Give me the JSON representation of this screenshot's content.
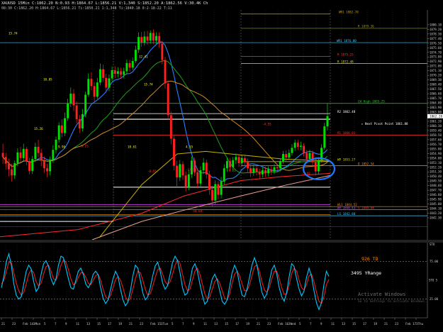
{
  "header": {
    "line1": "XAUUSD 15Min  C:1862.20  N:0.93  H:1864.67  L:1856.21  V:1,340  S:1852.20  A:1862.56  V:30.4K  Ch",
    "line2": "08:30  C:1862.20  H:1864.67  L:1856.21  Ti:1850.21  1:1,348  Ti:1840.18  0:2-18-22  T:11"
  },
  "chart_data": {
    "type": "line",
    "title": "XAUUSD 15Min",
    "ylim": [
      1838.0,
      1883.0
    ],
    "y_ticks": [
      1880.1,
      1879.2,
      1878.3,
      1877.4,
      1876.5,
      1875.6,
      1874.7,
      1873.8,
      1872.9,
      1872.0,
      1871.1,
      1870.2,
      1869.3,
      1868.4,
      1867.5,
      1866.6,
      1865.7,
      1864.8,
      1863.9,
      1863.0,
      1862.1,
      1861.2,
      1860.3,
      1859.4,
      1858.5,
      1857.6,
      1856.7,
      1855.8,
      1854.9,
      1854.0,
      1853.1,
      1852.2,
      1851.3,
      1850.4,
      1849.5,
      1848.6,
      1847.7,
      1846.8,
      1845.9,
      1845.0,
      1844.1,
      1843.2,
      1842.3
    ],
    "price_tag": "1862.20",
    "levels": [
      {
        "name": "WR1 1882.78",
        "value": 1882.2,
        "color": "#c8a000",
        "label_pos": "top"
      },
      {
        "name": "R 1879.36",
        "value": 1879.4,
        "color": "#a0a000",
        "label_pos": "right"
      },
      {
        "name": "WR1 1876.80",
        "value": 1876.6,
        "color": "#40c8ff",
        "label_pos": "left"
      },
      {
        "name": "R 1875.15",
        "value": 1873.9,
        "color": "#ff3030",
        "label_pos": "mid"
      },
      {
        "name": "R 1872.48",
        "value": 1872.5,
        "color": "#dddd00",
        "label_pos": "mid"
      },
      {
        "name": "LW High 1865.25",
        "value": 1864.7,
        "color": "#20d020",
        "label_pos": "right"
      },
      {
        "name": "R2 1862.48",
        "value": 1862.7,
        "color": "#ffffff",
        "label_pos": "mid"
      },
      {
        "name": "R1 1860.01",
        "value": 1858.5,
        "color": "#ff3030",
        "label_pos": "mid"
      },
      {
        "name": "WP 1853.27",
        "value": 1853.3,
        "color": "#dddd00",
        "label_pos": "mid"
      },
      {
        "name": "D 1852.54",
        "value": 1852.5,
        "color": "#ff8c00",
        "label_pos": "right"
      },
      {
        "name": "WL1 1844.52",
        "value": 1844.5,
        "color": "#ff8c00",
        "label_pos": "mid"
      },
      {
        "name": "WP 1844.43",
        "value": 1843.9,
        "color": "#d040ff",
        "label_pos": "mid"
      },
      {
        "name": "S 1844.04",
        "value": 1843.9,
        "color": "#ff3030",
        "label_pos": "right"
      },
      {
        "name": "LS 1842.88",
        "value": 1842.7,
        "color": "#40c8ff",
        "label_pos": "mid"
      }
    ],
    "annotations": [
      {
        "text": "Next Pivot Point 1861.88",
        "value": 1860.5,
        "color": "#ffffff"
      },
      {
        "text": "TD 926",
        "value": null,
        "color": "#ff8c00"
      },
      {
        "text": "YRange 3495",
        "value": null,
        "color": "#ffffff"
      },
      {
        "text": "15.74",
        "value": 1868.2,
        "color": "#ffff00"
      },
      {
        "text": "12.41",
        "value": 1873.6,
        "color": "#ffff00"
      },
      {
        "text": "10.85",
        "value": 1869.2,
        "color": "#ffff00"
      },
      {
        "text": "15.74",
        "value": 1878.2,
        "color": "#ffff00"
      },
      {
        "text": "15.26",
        "value": 1859.5,
        "color": "#ffff00"
      },
      {
        "text": "10.61",
        "value": 1856.0,
        "color": "#ffff00"
      },
      {
        "text": "9.96",
        "value": 1856.0,
        "color": "#ffff00"
      },
      {
        "text": "4.15",
        "value": 1856.0,
        "color": "#ffff00"
      },
      {
        "text": "-8.55",
        "value": 1851.2,
        "color": "#ff3030"
      },
      {
        "text": "-17.10",
        "value": 1851.5,
        "color": "#ff3030"
      },
      {
        "text": "-4.55",
        "value": 1860.4,
        "color": "#ff3030"
      },
      {
        "text": "-5.93",
        "value": 1850.8,
        "color": "#ff3030"
      },
      {
        "text": "-10.64",
        "value": 1843.4,
        "color": "#ff3030"
      },
      {
        "text": "-6.82",
        "value": 1853.6,
        "color": "#ff3030"
      },
      {
        "text": "-3.23",
        "value": 1856.1,
        "color": "#ff3030"
      },
      {
        "text": "-9.21",
        "value": 1851.3,
        "color": "#ff3030"
      }
    ],
    "oscillator": {
      "labels": [
        "STO",
        "STO 5"
      ],
      "levels": [
        "25.00",
        "75.00"
      ],
      "range": [
        0,
        100
      ],
      "fast": [
        40,
        55,
        75,
        85,
        70,
        45,
        30,
        25,
        28,
        45,
        62,
        70,
        65,
        48,
        35,
        40,
        58,
        72,
        76,
        68,
        52,
        44,
        52,
        70,
        82,
        80,
        66,
        52,
        40,
        38,
        50,
        62,
        66,
        58,
        45,
        40,
        46,
        58,
        62,
        57,
        40,
        26,
        19,
        24,
        38,
        52,
        62,
        55,
        38,
        24,
        16,
        21,
        36,
        56,
        70,
        66,
        50,
        33,
        24,
        28,
        40,
        56,
        69,
        74,
        62,
        46,
        38,
        43,
        58,
        74,
        82,
        76,
        60,
        40,
        30,
        33,
        48,
        66,
        72,
        62,
        45,
        30,
        18,
        22,
        38,
        52,
        58,
        50,
        36,
        22,
        18,
        24,
        42,
        60,
        70,
        62,
        45,
        30,
        28,
        38,
        54,
        70,
        80,
        70,
        52,
        34,
        26,
        32,
        48,
        64,
        70,
        58,
        40,
        28,
        22,
        34,
        55,
        72,
        68,
        52,
        38,
        29,
        36,
        54,
        66,
        55,
        36,
        20,
        11,
        20,
        44,
        62,
        55
      ],
      "slow": [
        45,
        50,
        62,
        74,
        73,
        60,
        46,
        36,
        30,
        34,
        45,
        58,
        64,
        60,
        48,
        42,
        46,
        58,
        68,
        70,
        62,
        52,
        50,
        58,
        70,
        77,
        74,
        64,
        52,
        44,
        46,
        54,
        60,
        60,
        54,
        46,
        44,
        50,
        56,
        58,
        50,
        38,
        28,
        25,
        30,
        40,
        51,
        55,
        50,
        40,
        28,
        22,
        26,
        38,
        52,
        62,
        60,
        50,
        38,
        30,
        32,
        42,
        54,
        64,
        66,
        58,
        48,
        44,
        48,
        58,
        70,
        77,
        72,
        58,
        44,
        36,
        38,
        50,
        62,
        66,
        58,
        45,
        32,
        24,
        28,
        38,
        48,
        52,
        46,
        36,
        26,
        24,
        32,
        46,
        58,
        62,
        56,
        45,
        36,
        36,
        44,
        56,
        68,
        70,
        62,
        48,
        37,
        34,
        40,
        52,
        62,
        62,
        52,
        40,
        31,
        32,
        44,
        59,
        66,
        62,
        50,
        40,
        37,
        44,
        56,
        58,
        48,
        34,
        22,
        19,
        28,
        44,
        51
      ],
      "last_values": [
        "73.50",
        "50.15"
      ]
    },
    "xaxis_labels": [
      "21",
      "23",
      "Feb 14 Mon",
      "3",
      "5",
      "7",
      "9",
      "11",
      "13",
      "15",
      "17",
      "19",
      "21",
      "23",
      "Feb 15 Tue",
      "3",
      "5",
      "7",
      "9",
      "11",
      "13",
      "15",
      "17",
      "19",
      "21",
      "23",
      "Feb 16 Wed",
      "3",
      "5",
      "7",
      "9",
      "11",
      "13",
      "15",
      "17",
      "19",
      "21",
      "23",
      "Feb 17 Thu",
      "3"
    ],
    "candles": [
      [
        1855.0,
        1854.2,
        1856.8,
        1852.9
      ],
      [
        1854.2,
        1852.9,
        1855.0,
        1851.8
      ],
      [
        1852.9,
        1851.8,
        1853.9,
        1850.4
      ],
      [
        1851.8,
        1850.6,
        1852.9,
        1849.4
      ],
      [
        1850.6,
        1853.0,
        1853.5,
        1849.9
      ],
      [
        1853.0,
        1855.1,
        1855.9,
        1852.4
      ],
      [
        1855.1,
        1854.0,
        1856.2,
        1853.2
      ],
      [
        1854.0,
        1855.8,
        1856.8,
        1853.3
      ],
      [
        1855.8,
        1853.4,
        1856.2,
        1852.6
      ],
      [
        1853.4,
        1851.5,
        1854.0,
        1850.8
      ],
      [
        1851.5,
        1853.8,
        1854.4,
        1850.9
      ],
      [
        1853.8,
        1856.2,
        1857.0,
        1853.2
      ],
      [
        1856.2,
        1855.0,
        1857.6,
        1854.2
      ],
      [
        1855.0,
        1853.5,
        1855.8,
        1852.4
      ],
      [
        1853.5,
        1852.0,
        1854.3,
        1851.1
      ],
      [
        1852.0,
        1851.4,
        1852.9,
        1850.3
      ],
      [
        1851.4,
        1853.6,
        1854.3,
        1850.6
      ],
      [
        1853.6,
        1855.6,
        1856.5,
        1853.1
      ],
      [
        1855.6,
        1857.6,
        1858.2,
        1854.9
      ],
      [
        1857.6,
        1860.4,
        1861.0,
        1857.0
      ],
      [
        1860.4,
        1858.9,
        1861.6,
        1858.1
      ],
      [
        1858.9,
        1861.8,
        1862.9,
        1858.3
      ],
      [
        1861.8,
        1864.7,
        1865.6,
        1861.3
      ],
      [
        1864.7,
        1866.6,
        1867.8,
        1864.0
      ],
      [
        1866.6,
        1864.3,
        1867.5,
        1863.2
      ],
      [
        1864.3,
        1861.6,
        1865.1,
        1860.8
      ],
      [
        1861.6,
        1859.8,
        1862.4,
        1858.9
      ],
      [
        1859.8,
        1862.6,
        1863.6,
        1859.2
      ],
      [
        1862.6,
        1866.4,
        1867.0,
        1862.0
      ],
      [
        1866.4,
        1869.5,
        1870.6,
        1866.0
      ],
      [
        1869.5,
        1868.1,
        1870.8,
        1867.3
      ],
      [
        1868.1,
        1866.0,
        1868.9,
        1865.1
      ],
      [
        1866.0,
        1868.8,
        1869.7,
        1865.6
      ],
      [
        1868.8,
        1871.4,
        1872.5,
        1868.2
      ],
      [
        1871.4,
        1869.7,
        1872.3,
        1868.9
      ],
      [
        1869.7,
        1867.8,
        1870.5,
        1866.8
      ],
      [
        1867.8,
        1869.6,
        1870.4,
        1867.1
      ],
      [
        1869.6,
        1871.2,
        1871.9,
        1869.0
      ],
      [
        1871.2,
        1870.5,
        1872.0,
        1869.6
      ],
      [
        1870.5,
        1871.0,
        1871.8,
        1869.8
      ],
      [
        1871.0,
        1870.3,
        1871.7,
        1869.5
      ],
      [
        1870.3,
        1871.0,
        1871.7,
        1869.6
      ],
      [
        1871.0,
        1872.6,
        1873.3,
        1870.4
      ],
      [
        1872.6,
        1871.7,
        1873.2,
        1870.9
      ],
      [
        1871.7,
        1873.0,
        1873.7,
        1871.2
      ],
      [
        1873.0,
        1875.2,
        1876.0,
        1872.6
      ],
      [
        1875.2,
        1877.7,
        1878.6,
        1874.6
      ],
      [
        1877.7,
        1876.6,
        1878.7,
        1875.8
      ],
      [
        1876.6,
        1877.8,
        1878.8,
        1876.0
      ],
      [
        1877.8,
        1877.0,
        1878.9,
        1876.2
      ],
      [
        1877.0,
        1878.5,
        1879.0,
        1876.4
      ],
      [
        1878.5,
        1877.0,
        1879.2,
        1876.3
      ],
      [
        1877.0,
        1877.9,
        1878.6,
        1876.3
      ],
      [
        1877.9,
        1876.4,
        1878.6,
        1875.6
      ],
      [
        1876.4,
        1873.2,
        1876.9,
        1872.4
      ],
      [
        1873.2,
        1868.6,
        1873.8,
        1867.6
      ],
      [
        1868.6,
        1862.4,
        1869.2,
        1861.5
      ],
      [
        1862.4,
        1857.8,
        1863.1,
        1856.7
      ],
      [
        1857.8,
        1852.5,
        1858.4,
        1851.6
      ],
      [
        1852.5,
        1850.2,
        1853.4,
        1848.3
      ],
      [
        1850.2,
        1852.8,
        1853.6,
        1849.5
      ],
      [
        1852.8,
        1850.6,
        1853.4,
        1849.7
      ],
      [
        1850.6,
        1848.3,
        1851.4,
        1847.4
      ],
      [
        1848.3,
        1850.8,
        1851.7,
        1847.7
      ],
      [
        1850.8,
        1853.5,
        1854.3,
        1850.1
      ],
      [
        1853.5,
        1851.2,
        1854.1,
        1850.5
      ],
      [
        1851.2,
        1849.0,
        1852.0,
        1848.1
      ],
      [
        1849.0,
        1851.6,
        1852.4,
        1848.3
      ],
      [
        1851.6,
        1853.1,
        1854.0,
        1850.9
      ],
      [
        1853.1,
        1850.8,
        1853.7,
        1850.0
      ],
      [
        1850.8,
        1847.8,
        1851.5,
        1846.8
      ],
      [
        1847.8,
        1845.7,
        1848.6,
        1844.5
      ],
      [
        1845.7,
        1848.9,
        1849.6,
        1845.0
      ],
      [
        1848.9,
        1846.8,
        1849.5,
        1845.9
      ],
      [
        1846.8,
        1849.4,
        1850.3,
        1846.1
      ],
      [
        1849.4,
        1852.0,
        1852.8,
        1848.8
      ],
      [
        1852.0,
        1853.4,
        1854.1,
        1851.3
      ],
      [
        1853.4,
        1852.2,
        1854.0,
        1851.4
      ],
      [
        1852.2,
        1853.6,
        1854.2,
        1851.5
      ],
      [
        1853.6,
        1854.2,
        1854.9,
        1852.8
      ],
      [
        1854.2,
        1853.0,
        1854.8,
        1852.3
      ],
      [
        1853.0,
        1854.0,
        1854.6,
        1852.4
      ],
      [
        1854.0,
        1853.2,
        1854.7,
        1852.4
      ],
      [
        1853.2,
        1852.0,
        1853.9,
        1851.2
      ],
      [
        1852.0,
        1851.1,
        1852.7,
        1850.3
      ],
      [
        1851.1,
        1852.0,
        1852.7,
        1850.5
      ],
      [
        1852.0,
        1851.3,
        1852.6,
        1850.6
      ],
      [
        1851.3,
        1850.8,
        1851.9,
        1850.0
      ],
      [
        1850.8,
        1851.6,
        1852.2,
        1850.2
      ],
      [
        1851.6,
        1851.0,
        1852.3,
        1850.3
      ],
      [
        1851.0,
        1851.8,
        1852.4,
        1850.4
      ],
      [
        1851.8,
        1851.4,
        1852.4,
        1850.7
      ],
      [
        1851.4,
        1852.2,
        1852.8,
        1850.9
      ],
      [
        1852.2,
        1852.0,
        1852.9,
        1851.2
      ],
      [
        1852.0,
        1853.4,
        1853.9,
        1851.4
      ],
      [
        1853.4,
        1854.8,
        1855.4,
        1852.9
      ],
      [
        1854.8,
        1854.1,
        1855.5,
        1853.4
      ],
      [
        1854.1,
        1855.0,
        1855.7,
        1853.6
      ],
      [
        1855.0,
        1856.0,
        1856.7,
        1854.5
      ],
      [
        1856.0,
        1857.0,
        1857.6,
        1855.4
      ],
      [
        1857.0,
        1856.2,
        1857.6,
        1855.6
      ],
      [
        1856.2,
        1856.4,
        1857.2,
        1855.5
      ],
      [
        1856.4,
        1855.0,
        1856.9,
        1854.3
      ],
      [
        1855.0,
        1853.8,
        1855.6,
        1853.0
      ],
      [
        1853.8,
        1855.0,
        1855.6,
        1853.2
      ],
      [
        1855.0,
        1853.2,
        1855.5,
        1852.3
      ],
      [
        1853.2,
        1851.4,
        1853.8,
        1850.6
      ],
      [
        1851.4,
        1853.6,
        1854.2,
        1850.9
      ],
      [
        1853.6,
        1856.0,
        1856.7,
        1853.1
      ],
      [
        1856.0,
        1860.2,
        1860.9,
        1855.6
      ],
      [
        1860.2,
        1862.2,
        1864.7,
        1859.4
      ]
    ]
  },
  "ui": {
    "watermark_title": "Activate Windows",
    "watermark_sub": "Go to Settings to activate Windows.",
    "sto_label": "STO",
    "colors": {
      "bull": "#00e000",
      "bear": "#ff2020",
      "osc_fast": "#00c8ff",
      "osc_slow": "#e02020"
    }
  }
}
